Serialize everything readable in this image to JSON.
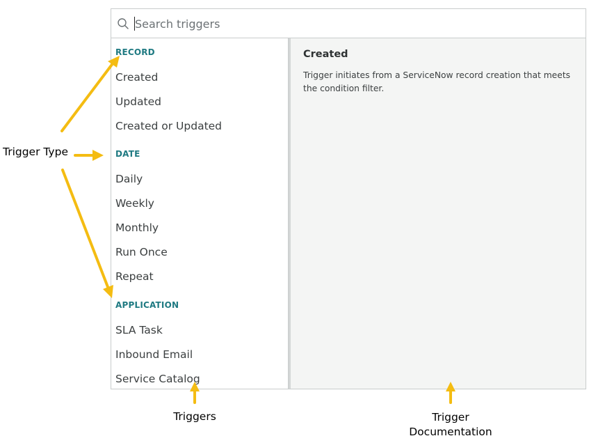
{
  "search": {
    "placeholder": "Search triggers",
    "value": ""
  },
  "groups": [
    {
      "heading": "RECORD",
      "items": [
        "Created",
        "Updated",
        "Created or Updated"
      ]
    },
    {
      "heading": "DATE",
      "items": [
        "Daily",
        "Weekly",
        "Monthly",
        "Run Once",
        "Repeat"
      ]
    },
    {
      "heading": "APPLICATION",
      "items": [
        "SLA Task",
        "Inbound Email",
        "Service Catalog"
      ]
    }
  ],
  "documentation": {
    "title": "Created",
    "body": "Trigger initiates from a ServiceNow record creation that meets the condition filter."
  },
  "annotations": {
    "trigger_type": "Trigger Type",
    "triggers": "Triggers",
    "trigger_documentation": "Trigger Documentation"
  },
  "colors": {
    "heading": "#1f7a82",
    "arrow": "#f4bc12",
    "doc_bg": "#f4f5f4"
  },
  "icons": {
    "search": "search-icon"
  }
}
